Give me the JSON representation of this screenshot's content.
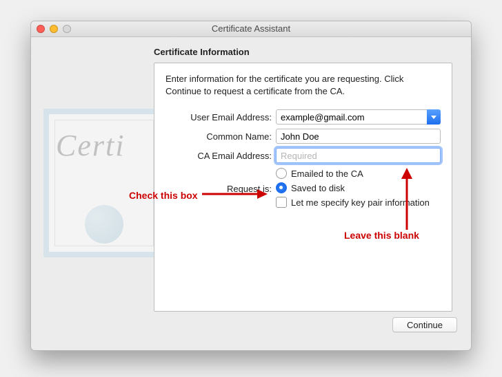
{
  "window": {
    "title": "Certificate Assistant"
  },
  "heading": "Certificate Information",
  "intro": "Enter information for the certificate you are requesting. Click Continue to request a certificate from the CA.",
  "form": {
    "email_label": "User Email Address:",
    "email_value": "example@gmail.com",
    "common_name_label": "Common Name:",
    "common_name_value": "John Doe",
    "ca_email_label": "CA Email Address:",
    "ca_email_placeholder": "Required",
    "request_is_label": "Request is:",
    "option_emailed": "Emailed to the CA",
    "option_saved": "Saved to disk",
    "checkbox_label": "Let me specify key pair information"
  },
  "buttons": {
    "continue": "Continue"
  },
  "annotations": {
    "check_box": "Check this box",
    "leave_blank": "Leave this blank"
  },
  "art": {
    "cert_word": "Certi"
  }
}
